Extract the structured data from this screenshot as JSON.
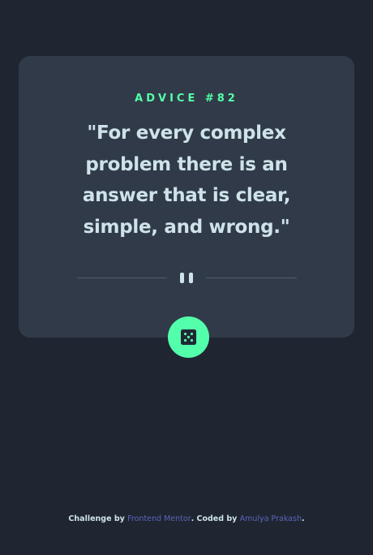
{
  "advice": {
    "label": "ADVICE #82",
    "quote": "\"For every complex problem there is an answer that is clear, simple, and wrong.\""
  },
  "footer": {
    "prefix": "Challenge by ",
    "challenge_link": "Frontend Mentor",
    "middle": ". Coded by ",
    "author_link": "Amulya Prakash",
    "suffix": "."
  },
  "icons": {
    "divider": "pause-icon",
    "button": "dice-icon"
  },
  "colors": {
    "background": "#1f2632",
    "card": "#313a48",
    "accent": "#53ffaa",
    "text": "#cee3e9",
    "link": "#5a65b8"
  }
}
